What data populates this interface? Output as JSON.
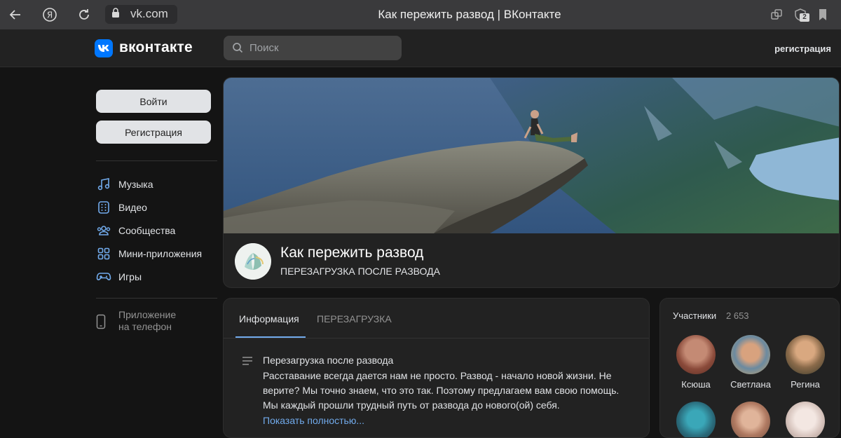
{
  "browser": {
    "url": "vk.com",
    "tab_title": "Как пережить развод | ВКонтакте",
    "badge_count": "2"
  },
  "header": {
    "logo_text": "вконтакте",
    "search_placeholder": "Поиск",
    "register_link": "регистрация"
  },
  "sidebar": {
    "login_button": "Войти",
    "register_button": "Регистрация",
    "nav": [
      {
        "label": "Музыка",
        "icon": "music-icon"
      },
      {
        "label": "Видео",
        "icon": "video-icon"
      },
      {
        "label": "Сообщества",
        "icon": "communities-icon"
      },
      {
        "label": "Мини-приложения",
        "icon": "mini-apps-icon"
      },
      {
        "label": "Игры",
        "icon": "gamepad-icon"
      }
    ],
    "phone_app_line1": "Приложение",
    "phone_app_line2": "на телефон"
  },
  "group": {
    "title": "Как пережить развод",
    "subtitle": "ПЕРЕЗАГРУЗКА ПОСЛЕ РАЗВОДА"
  },
  "info": {
    "tabs": [
      "Информация",
      "ПЕРЕЗАГРУЗКА"
    ],
    "desc_title": "Перезагрузка после развода",
    "desc_text": "Расставание всегда дается нам не просто. Развод - начало новой жизни. Не верите? Мы точно знаем, что это так. Поэтому предлагаем вам свою помощь. Мы каждый прошли трудный путь от развода до нового(ой) себя.",
    "show_more": "Показать полностью..."
  },
  "members": {
    "title": "Участники",
    "count": "2 653",
    "list": [
      {
        "name": "Ксюша"
      },
      {
        "name": "Светлана"
      },
      {
        "name": "Регина"
      }
    ]
  },
  "colors": {
    "accent": "#71aaeb",
    "vk_blue": "#0077ff",
    "card_bg": "#222222",
    "page_bg": "#141414"
  }
}
